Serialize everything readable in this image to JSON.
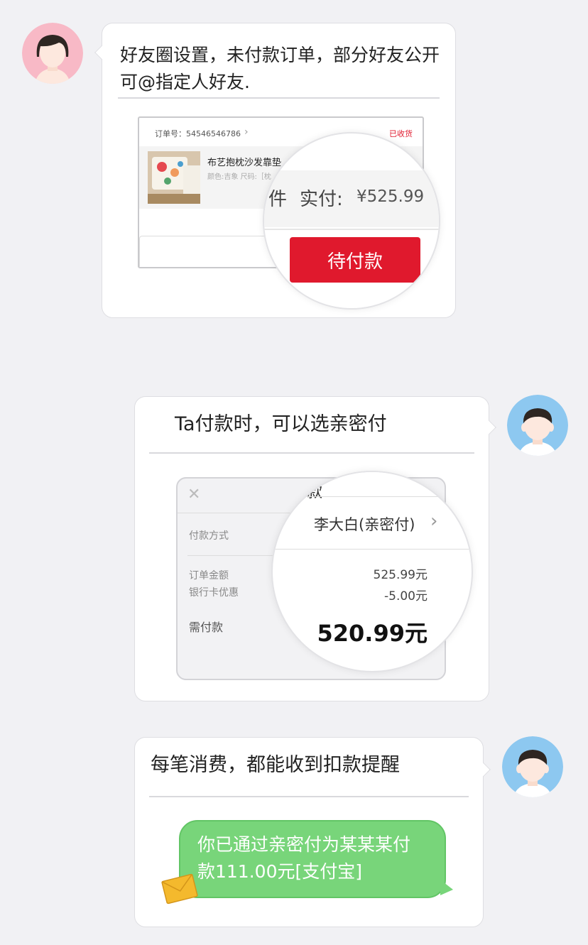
{
  "message1": {
    "text_line1": "好友圈设置，未付款订单，部分好友公开",
    "text_line2": "可@指定人好友.",
    "order": {
      "order_no_label": "订单号：54546546786",
      "status": "已收货",
      "product_name": "布艺抱枕沙发靠垫",
      "product_spec": "颜色:吉象 尺码:［枕",
      "summary_prefix": "件",
      "paid_label": "实付:",
      "paid_amount": "¥525.99",
      "pay_button": "待付款"
    }
  },
  "message2": {
    "text": "Ta付款时，可以选亲密付",
    "payment": {
      "title": "付款",
      "method_label": "付款方式",
      "method_value": "李大白(亲密付)",
      "order_amount_label": "订单金额",
      "order_amount": "525.99元",
      "discount_label": "银行卡优惠",
      "discount": "-5.00元",
      "due_label": "需付款",
      "due_amount": "520.99元"
    }
  },
  "message3": {
    "text": "每笔消费，都能收到扣款提醒",
    "sms_line1": "你已通过亲密付为某某某付",
    "sms_line2": "款111.00元[支付宝]"
  },
  "colors": {
    "accent_red": "#e0192d",
    "sms_green": "#78d57a",
    "alipay_blue": "#1aa0e5"
  },
  "icons": [
    "female-avatar-icon",
    "male-avatar-icon",
    "chevron-right-icon",
    "close-icon",
    "alipay-icon",
    "envelope-icon"
  ]
}
